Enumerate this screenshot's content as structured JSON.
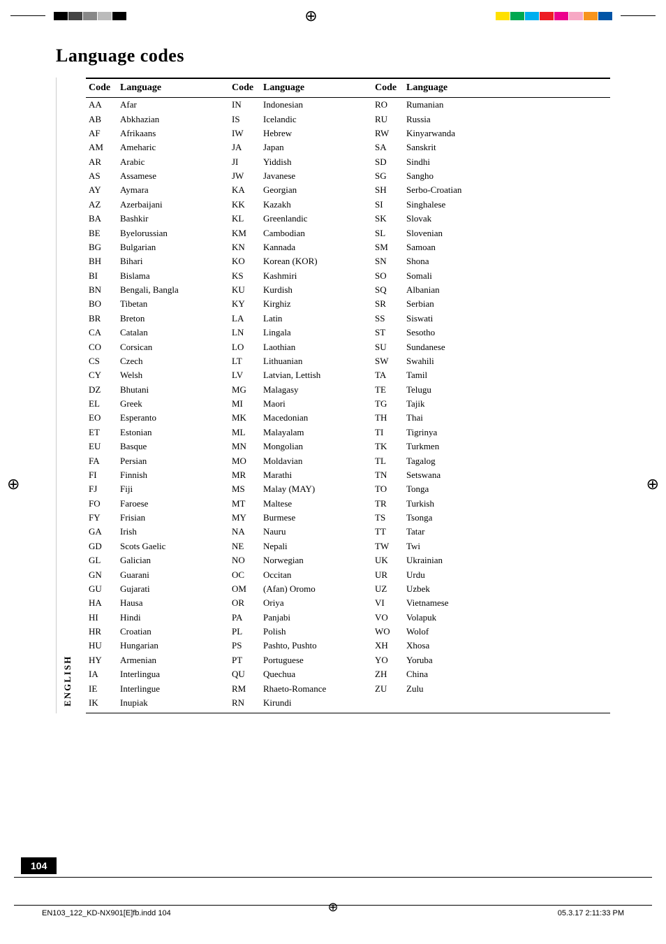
{
  "page": {
    "title": "Language codes",
    "page_number": "104",
    "file_info": "EN103_122_KD-NX901[E]fb.indd  104",
    "date_info": "05.3.17   2:11:33 PM"
  },
  "sidebar": {
    "label": "ENGLISH"
  },
  "table": {
    "headers": [
      "Code",
      "Language",
      "Code",
      "Language",
      "Code",
      "Language"
    ],
    "rows": [
      [
        "AA",
        "Afar",
        "IN",
        "Indonesian",
        "RO",
        "Rumanian"
      ],
      [
        "AB",
        "Abkhazian",
        "IS",
        "Icelandic",
        "RU",
        "Russia"
      ],
      [
        "AF",
        "Afrikaans",
        "IW",
        "Hebrew",
        "RW",
        "Kinyarwanda"
      ],
      [
        "AM",
        "Ameharic",
        "JA",
        "Japan",
        "SA",
        "Sanskrit"
      ],
      [
        "AR",
        "Arabic",
        "JI",
        "Yiddish",
        "SD",
        "Sindhi"
      ],
      [
        "AS",
        "Assamese",
        "JW",
        "Javanese",
        "SG",
        "Sangho"
      ],
      [
        "AY",
        "Aymara",
        "KA",
        "Georgian",
        "SH",
        "Serbo-Croatian"
      ],
      [
        "AZ",
        "Azerbaijani",
        "KK",
        "Kazakh",
        "SI",
        "Singhalese"
      ],
      [
        "BA",
        "Bashkir",
        "KL",
        "Greenlandic",
        "SK",
        "Slovak"
      ],
      [
        "BE",
        "Byelorussian",
        "KM",
        "Cambodian",
        "SL",
        "Slovenian"
      ],
      [
        "BG",
        "Bulgarian",
        "KN",
        "Kannada",
        "SM",
        "Samoan"
      ],
      [
        "BH",
        "Bihari",
        "KO",
        "Korean (KOR)",
        "SN",
        "Shona"
      ],
      [
        "BI",
        "Bislama",
        "KS",
        "Kashmiri",
        "SO",
        "Somali"
      ],
      [
        "BN",
        "Bengali, Bangla",
        "KU",
        "Kurdish",
        "SQ",
        "Albanian"
      ],
      [
        "BO",
        "Tibetan",
        "KY",
        "Kirghiz",
        "SR",
        "Serbian"
      ],
      [
        "BR",
        "Breton",
        "LA",
        "Latin",
        "SS",
        "Siswati"
      ],
      [
        "CA",
        "Catalan",
        "LN",
        "Lingala",
        "ST",
        "Sesotho"
      ],
      [
        "CO",
        "Corsican",
        "LO",
        "Laothian",
        "SU",
        "Sundanese"
      ],
      [
        "CS",
        "Czech",
        "LT",
        "Lithuanian",
        "SW",
        "Swahili"
      ],
      [
        "CY",
        "Welsh",
        "LV",
        "Latvian, Lettish",
        "TA",
        "Tamil"
      ],
      [
        "DZ",
        "Bhutani",
        "MG",
        "Malagasy",
        "TE",
        "Telugu"
      ],
      [
        "EL",
        "Greek",
        "MI",
        "Maori",
        "TG",
        "Tajik"
      ],
      [
        "EO",
        "Esperanto",
        "MK",
        "Macedonian",
        "TH",
        "Thai"
      ],
      [
        "ET",
        "Estonian",
        "ML",
        "Malayalam",
        "TI",
        "Tigrinya"
      ],
      [
        "EU",
        "Basque",
        "MN",
        "Mongolian",
        "TK",
        "Turkmen"
      ],
      [
        "FA",
        "Persian",
        "MO",
        "Moldavian",
        "TL",
        "Tagalog"
      ],
      [
        "FI",
        "Finnish",
        "MR",
        "Marathi",
        "TN",
        "Setswana"
      ],
      [
        "FJ",
        "Fiji",
        "MS",
        "Malay (MAY)",
        "TO",
        "Tonga"
      ],
      [
        "FO",
        "Faroese",
        "MT",
        "Maltese",
        "TR",
        "Turkish"
      ],
      [
        "FY",
        "Frisian",
        "MY",
        "Burmese",
        "TS",
        "Tsonga"
      ],
      [
        "GA",
        "Irish",
        "NA",
        "Nauru",
        "TT",
        "Tatar"
      ],
      [
        "GD",
        "Scots Gaelic",
        "NE",
        "Nepali",
        "TW",
        "Twi"
      ],
      [
        "GL",
        "Galician",
        "NO",
        "Norwegian",
        "UK",
        "Ukrainian"
      ],
      [
        "GN",
        "Guarani",
        "OC",
        "Occitan",
        "UR",
        "Urdu"
      ],
      [
        "GU",
        "Gujarati",
        "OM",
        "(Afan) Oromo",
        "UZ",
        "Uzbek"
      ],
      [
        "HA",
        "Hausa",
        "OR",
        "Oriya",
        "VI",
        "Vietnamese"
      ],
      [
        "HI",
        "Hindi",
        "PA",
        "Panjabi",
        "VO",
        "Volapuk"
      ],
      [
        "HR",
        "Croatian",
        "PL",
        "Polish",
        "WO",
        "Wolof"
      ],
      [
        "HU",
        "Hungarian",
        "PS",
        "Pashto, Pushto",
        "XH",
        "Xhosa"
      ],
      [
        "HY",
        "Armenian",
        "PT",
        "Portuguese",
        "YO",
        "Yoruba"
      ],
      [
        "IA",
        "Interlingua",
        "QU",
        "Quechua",
        "ZH",
        "China"
      ],
      [
        "IE",
        "Interlingue",
        "RM",
        "Rhaeto-Romance",
        "ZU",
        "Zulu"
      ],
      [
        "IK",
        "Inupiak",
        "RN",
        "Kirundi",
        "",
        ""
      ]
    ]
  }
}
